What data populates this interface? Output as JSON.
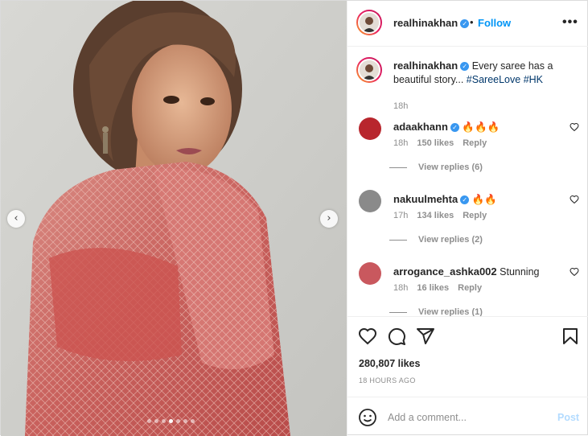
{
  "header": {
    "username": "realhinakhan",
    "separator": "•",
    "follow_label": "Follow",
    "more_label": "•••"
  },
  "caption": {
    "username": "realhinakhan",
    "text_prefix": "Every saree has a beautiful story...",
    "hashtags": [
      "#SareeLove",
      "#HK"
    ],
    "time": "18h"
  },
  "comments": [
    {
      "username": "adaakhann",
      "verified": true,
      "text": "🔥🔥🔥",
      "time": "18h",
      "likes": "150 likes",
      "reply_label": "Reply",
      "view_replies": "View replies (6)",
      "avatar_color": "#b8262d"
    },
    {
      "username": "nakuulmehta",
      "verified": true,
      "text": "🔥🔥",
      "time": "17h",
      "likes": "134 likes",
      "reply_label": "Reply",
      "view_replies": "View replies (2)",
      "avatar_color": "#8a8a8a"
    },
    {
      "username": "arrogance_ashka002",
      "verified": false,
      "text": "Stunning",
      "time": "18h",
      "likes": "16 likes",
      "reply_label": "Reply",
      "view_replies": "View replies (1)",
      "avatar_color": "#c9585e"
    }
  ],
  "actions": {
    "likes_count": "280,807 likes",
    "posted_ago": "18 HOURS AGO",
    "icons": [
      "heart-icon",
      "comment-icon",
      "share-icon",
      "bookmark-icon"
    ]
  },
  "add_comment": {
    "placeholder": "Add a comment...",
    "post_label": "Post"
  },
  "carousel": {
    "prev_label": "‹",
    "next_label": "›",
    "total_slides": 7,
    "active_slide": 4
  },
  "colors": {
    "link_blue": "#0095f6",
    "hashtag": "#00376b",
    "muted": "#8e8e8e",
    "post_disabled": "#b3dbff",
    "verified": "#3897f0"
  }
}
